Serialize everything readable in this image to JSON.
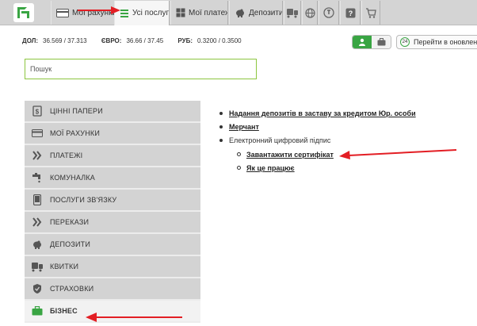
{
  "topnav": {
    "logo_icon": "privatbank-logo-icon",
    "tabs": [
      {
        "label": "Мої рахунки",
        "icon": "card-icon"
      },
      {
        "label": "Усі послуги",
        "icon": "list-icon",
        "active": true
      },
      {
        "label": "Мої платежі",
        "icon": "grid-icon"
      },
      {
        "label": "Депозити",
        "icon": "piggy-bank-icon"
      }
    ],
    "icon_buttons": [
      "transport-icon",
      "globe-icon",
      "dial-icon",
      "help-icon",
      "cart-icon"
    ]
  },
  "currency": {
    "usd_label": "ДОЛ:",
    "usd_value": "36.569 / 37.313",
    "eur_label": "ЄВРО:",
    "eur_value": "36.66 / 37.45",
    "rub_label": "РУБ:",
    "rub_value": "0.3200 / 0.3500"
  },
  "header_right": {
    "goto_old_badge": "24",
    "goto_old_label": "Перейти в оновлену"
  },
  "search": {
    "placeholder": "Пошук"
  },
  "menu": {
    "items": [
      {
        "label": "ЦІННІ ПАПЕРИ",
        "icon": "document-dollar-icon"
      },
      {
        "label": "МОЇ РАХУНКИ",
        "icon": "card-icon"
      },
      {
        "label": "ПЛАТЕЖІ",
        "icon": "double-chevron-icon"
      },
      {
        "label": "КОМУНАЛКА",
        "icon": "faucet-icon"
      },
      {
        "label": "ПОСЛУГИ ЗВ'ЯЗКУ",
        "icon": "phone-icon"
      },
      {
        "label": "ПЕРЕКАЗИ",
        "icon": "double-chevron-icon"
      },
      {
        "label": "ДЕПОЗИТИ",
        "icon": "piggy-bank-icon"
      },
      {
        "label": "КВИТКИ",
        "icon": "transport-icon"
      },
      {
        "label": "СТРАХОВКИ",
        "icon": "shield-icon"
      },
      {
        "label": "БІЗНЕС",
        "icon": "briefcase-icon",
        "active": true
      }
    ]
  },
  "content": {
    "links": [
      {
        "label": "Надання депозитів в заставу за кредитом Юр. особи"
      },
      {
        "label": "Мерчант"
      }
    ],
    "esign_label": "Електронний цифровий підпис",
    "esign_sub": [
      {
        "label": "Завантажити сертифікат"
      },
      {
        "label": "Як це працює"
      }
    ]
  },
  "annotation_color": "#e31e24",
  "accent_color": "#39a543"
}
